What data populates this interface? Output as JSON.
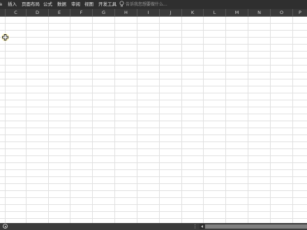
{
  "menu": {
    "items": [
      {
        "id": "a",
        "label": "a"
      },
      {
        "id": "insert",
        "label": "插入"
      },
      {
        "id": "layout",
        "label": "页面布局"
      },
      {
        "id": "formulas",
        "label": "公式"
      },
      {
        "id": "data",
        "label": "数据"
      },
      {
        "id": "review",
        "label": "审阅"
      },
      {
        "id": "view",
        "label": "视图"
      },
      {
        "id": "developer",
        "label": "开发工具"
      }
    ],
    "tell_me_placeholder": "告诉我您想要做什么...",
    "tell_me_icon": "lightbulb-icon"
  },
  "columns": [
    "C",
    "D",
    "E",
    "F",
    "G",
    "H",
    "I",
    "J",
    "K",
    "L",
    "M",
    "N",
    "O",
    "P"
  ],
  "statusbar": {
    "new_sheet_icon": "plus-circle-icon",
    "dots": "⋮"
  },
  "colors": {
    "menubar": "#2f2f2f",
    "header": "#3a3a3a",
    "gridline": "#e1e1e1",
    "cursor_highlight": "#fff8c4"
  }
}
